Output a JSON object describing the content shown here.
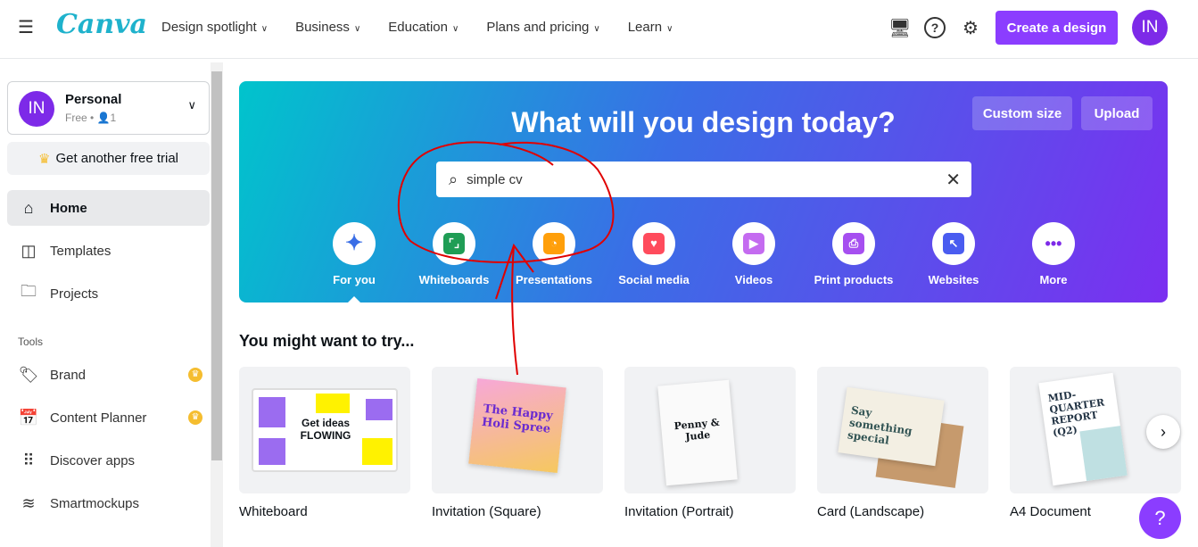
{
  "header": {
    "logo": "Canva",
    "nav": [
      "Design spotlight",
      "Business",
      "Education",
      "Plans and pricing",
      "Learn"
    ],
    "create_label": "Create a design",
    "avatar": "IN"
  },
  "sidebar": {
    "account": {
      "avatar": "IN",
      "name": "Personal",
      "plan": "Free",
      "members": "1"
    },
    "trial_label": "Get another free trial",
    "items": [
      {
        "label": "Home",
        "icon": "home-icon"
      },
      {
        "label": "Templates",
        "icon": "templates-icon"
      },
      {
        "label": "Projects",
        "icon": "folder-icon"
      }
    ],
    "tools_heading": "Tools",
    "tools": [
      {
        "label": "Brand",
        "icon": "brand-icon",
        "pro": true
      },
      {
        "label": "Content Planner",
        "icon": "calendar-icon",
        "pro": true
      },
      {
        "label": "Discover apps",
        "icon": "apps-grid-icon"
      },
      {
        "label": "Smartmockups",
        "icon": "layers-icon"
      }
    ]
  },
  "banner": {
    "title": "What will you design today?",
    "custom_size": "Custom size",
    "upload": "Upload",
    "search_value": "simple cv",
    "categories": [
      {
        "label": "For you",
        "color": "#3a6ee6"
      },
      {
        "label": "Whiteboards",
        "color": "#1f9d55"
      },
      {
        "label": "Presentations",
        "color": "#ff9f0a"
      },
      {
        "label": "Social media",
        "color": "#ff4b5c"
      },
      {
        "label": "Videos",
        "color": "#c46bf0"
      },
      {
        "label": "Print products",
        "color": "#a64ff0"
      },
      {
        "label": "Websites",
        "color": "#4a5cf0"
      },
      {
        "label": "More",
        "color": "#7d2ae8"
      }
    ]
  },
  "suggestions": {
    "heading": "You might want to try...",
    "cards": [
      {
        "label": "Whiteboard",
        "thumb_text": "Get ideas FLOWING"
      },
      {
        "label": "Invitation (Square)",
        "thumb_text": "The Happy Holi Spree"
      },
      {
        "label": "Invitation (Portrait)",
        "thumb_text": "Penny & Jude"
      },
      {
        "label": "Card (Landscape)",
        "thumb_text": "Say something special"
      },
      {
        "label": "A4 Document",
        "thumb_text": "MID-QUARTER REPORT (Q2)"
      }
    ]
  },
  "help_label": "?",
  "colors": {
    "accent": "#8b3dff",
    "annotation": "#e00000"
  }
}
